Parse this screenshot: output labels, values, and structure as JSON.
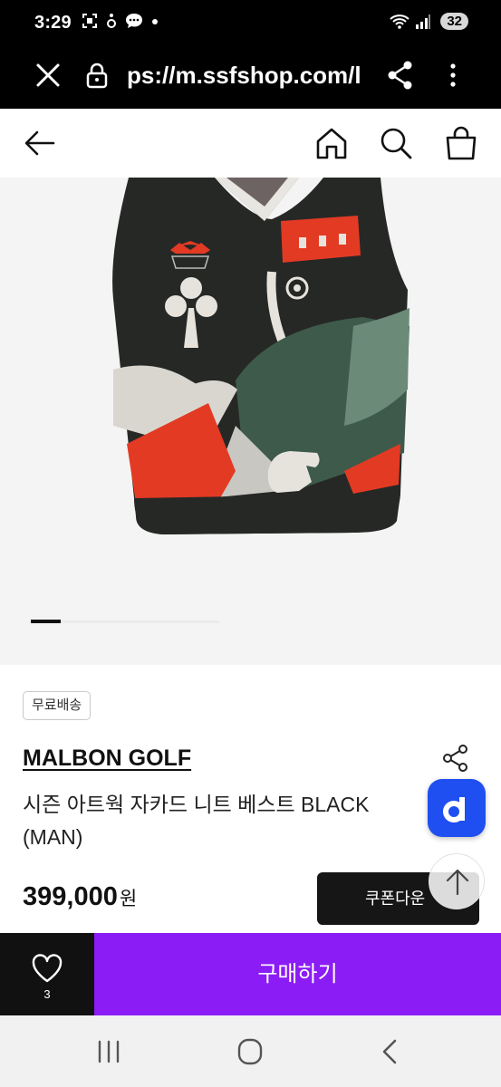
{
  "status_bar": {
    "time": "3:29",
    "battery": "32"
  },
  "browser": {
    "url": "ps://m.ssfshop.com/l"
  },
  "product": {
    "shipping_badge": "무료배송",
    "brand": "MALBON GOLF",
    "title": "시즌 아트웍 자카드 니트 베스트 BLACK (MAN)",
    "price": "399,000",
    "price_unit": "원",
    "coupon_label": "쿠폰다운",
    "image_count": 5,
    "image_index": 1
  },
  "bottom_bar": {
    "wish_count": "3",
    "buy_label": "구매하기"
  },
  "colors": {
    "buy_button": "#8b1cf5",
    "wish_button": "#111111",
    "float_button": "#1f4ff0"
  },
  "icons": {
    "floating_app_button": "d-logo-icon",
    "back": "arrow-left-icon",
    "home": "home-icon",
    "search": "search-icon",
    "cart": "shopping-bag-icon"
  }
}
